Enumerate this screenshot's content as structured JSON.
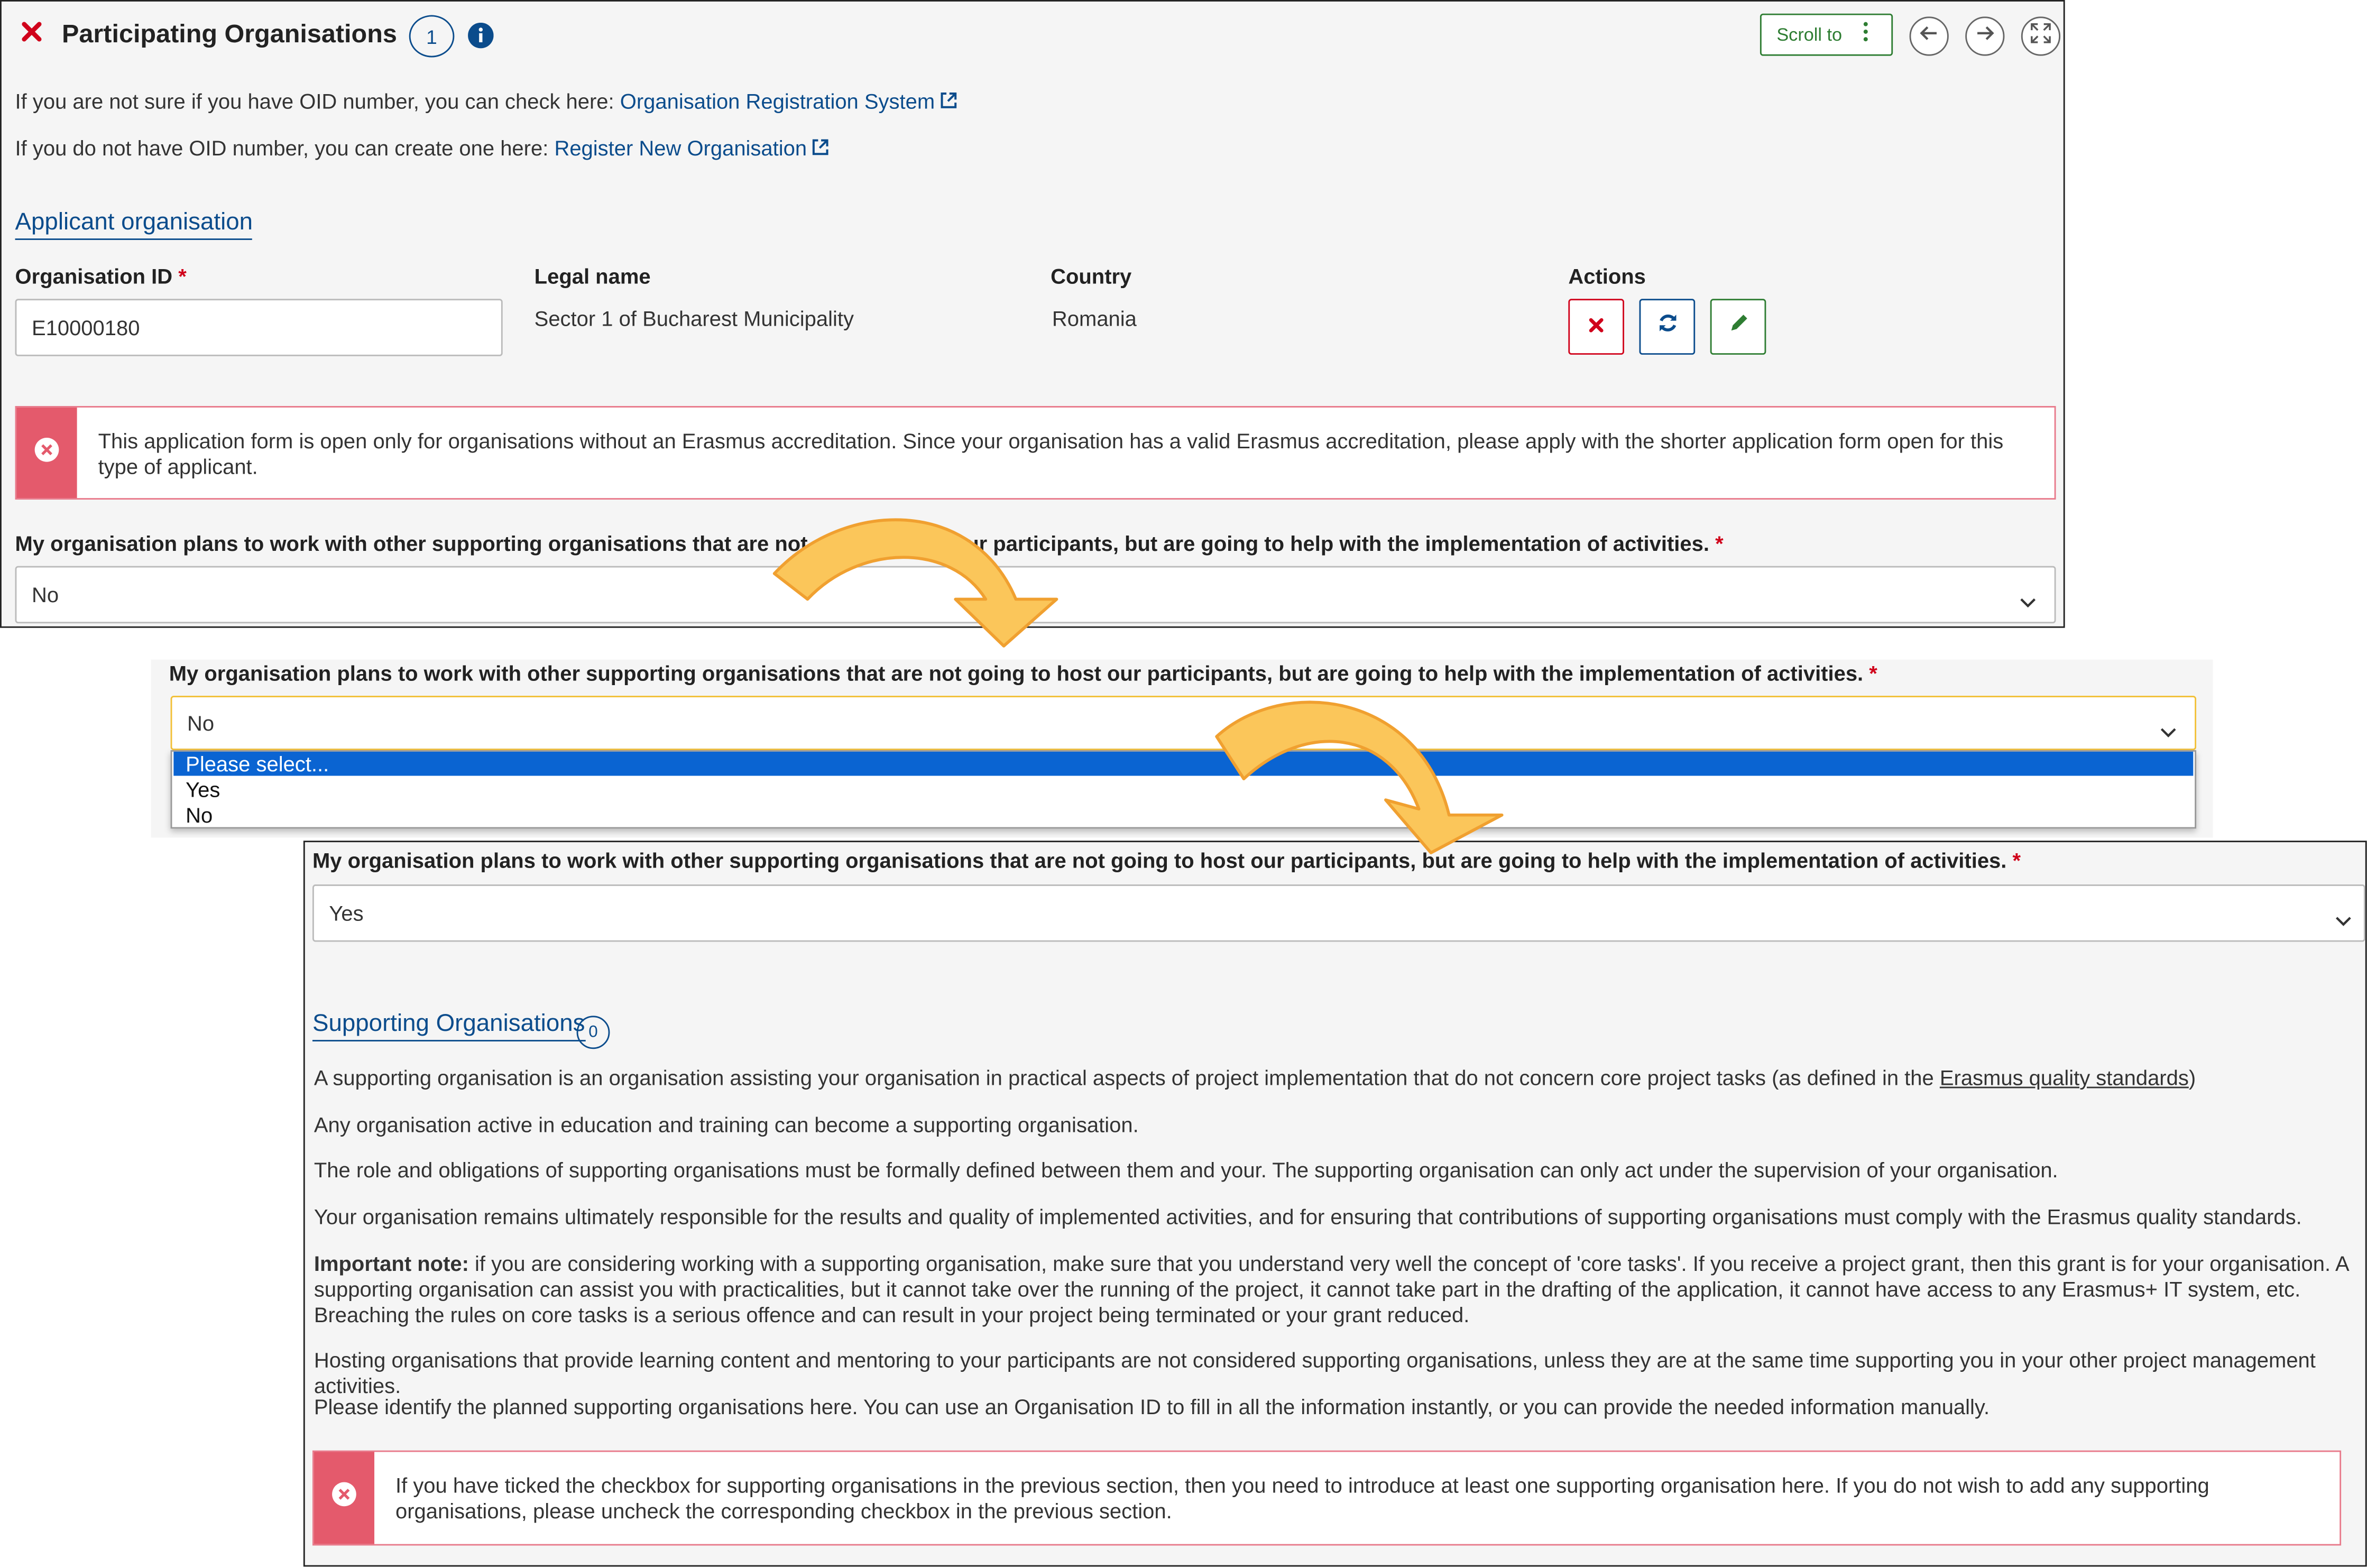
{
  "colors": {
    "link": "#0b4c8c",
    "required": "#d0021b",
    "alert_bar": "#e45a6c",
    "selected_option": "#0a64d2",
    "arrow_fill": "#fbc65a",
    "arrow_stroke": "#f0a030"
  },
  "panel_top": {
    "title": "Participating Organisations",
    "count_badge": "1",
    "scroll_to_label": "Scroll to",
    "oid_check_text": "If you are not sure if you have OID number, you can check here:",
    "oid_check_link": "Organisation Registration System",
    "oid_create_text": "If you do not have OID number, you can create one here:",
    "oid_create_link": "Register New Organisation",
    "section_heading": "Applicant organisation",
    "columns": {
      "org_id": "Organisation ID",
      "legal_name": "Legal name",
      "country": "Country",
      "actions": "Actions"
    },
    "required_mark": "*",
    "org_id_value": "E10000180",
    "legal_name_value": "Sector 1 of Bucharest Municipality",
    "country_value": "Romania",
    "alert_text": "This application form is open only for organisations without an Erasmus accreditation. Since your organisation has a valid Erasmus accreditation, please apply with the shorter application form open for this type of applicant.",
    "question": "My organisation plans to work with other supporting organisations that are not going to host our participants, but are going to help with the implementation of activities.",
    "question_value": "No"
  },
  "dropdown_panel": {
    "question": "My organisation plans to work with other supporting organisations that are not going to host our participants, but are going to help with the implementation of activities.",
    "current_value": "No",
    "options": [
      "Please select...",
      "Yes",
      "No"
    ],
    "highlighted_option": "Please select..."
  },
  "panel_bottom": {
    "question": "My organisation plans to work with other supporting organisations that are not going to host our participants, but are going to help with the implementation of activities.",
    "question_value": "Yes",
    "section_heading": "Supporting Organisations",
    "count_badge": "0",
    "p1_before": "A supporting organisation is an organisation assisting your organisation in practical aspects of project implementation that do not concern core project tasks (as defined in the ",
    "p1_link": "Erasmus quality standards",
    "p1_after": ")",
    "p2": "Any organisation active in education and training can become a supporting organisation.",
    "p3": "The role and obligations of supporting organisations must be formally defined between them and your. The supporting organisation can only act under the supervision of your organisation.",
    "p4": "Your organisation remains ultimately responsible for the results and quality of implemented activities, and for ensuring that contributions of supporting organisations must comply with the Erasmus quality standards.",
    "p5_bold": "Important note:",
    "p5_rest": " if you are considering working with a supporting organisation, make sure that you understand very well the concept of 'core tasks'. If you receive a project grant, then this grant is for your organisation. A supporting organisation can assist you with practicalities, but it cannot take over the running of the project, it cannot take part in the drafting of the application, it cannot have access to any Erasmus+ IT system, etc. Breaching the rules on core tasks is a serious offence and can result in your project being terminated or your grant reduced.",
    "p6": "Hosting organisations that provide learning content and mentoring to your participants are not considered supporting organisations, unless they are at the same time supporting you in your other project management activities.",
    "p7": "Please identify the planned supporting organisations here. You can use an Organisation ID to fill in all the information instantly, or you can provide the needed information manually.",
    "alert_text": "If you have ticked the checkbox for supporting organisations in the previous section, then you need to introduce at least one supporting organisation here. If you do not wish to add any supporting organisations, please uncheck the corresponding checkbox in the previous section."
  }
}
